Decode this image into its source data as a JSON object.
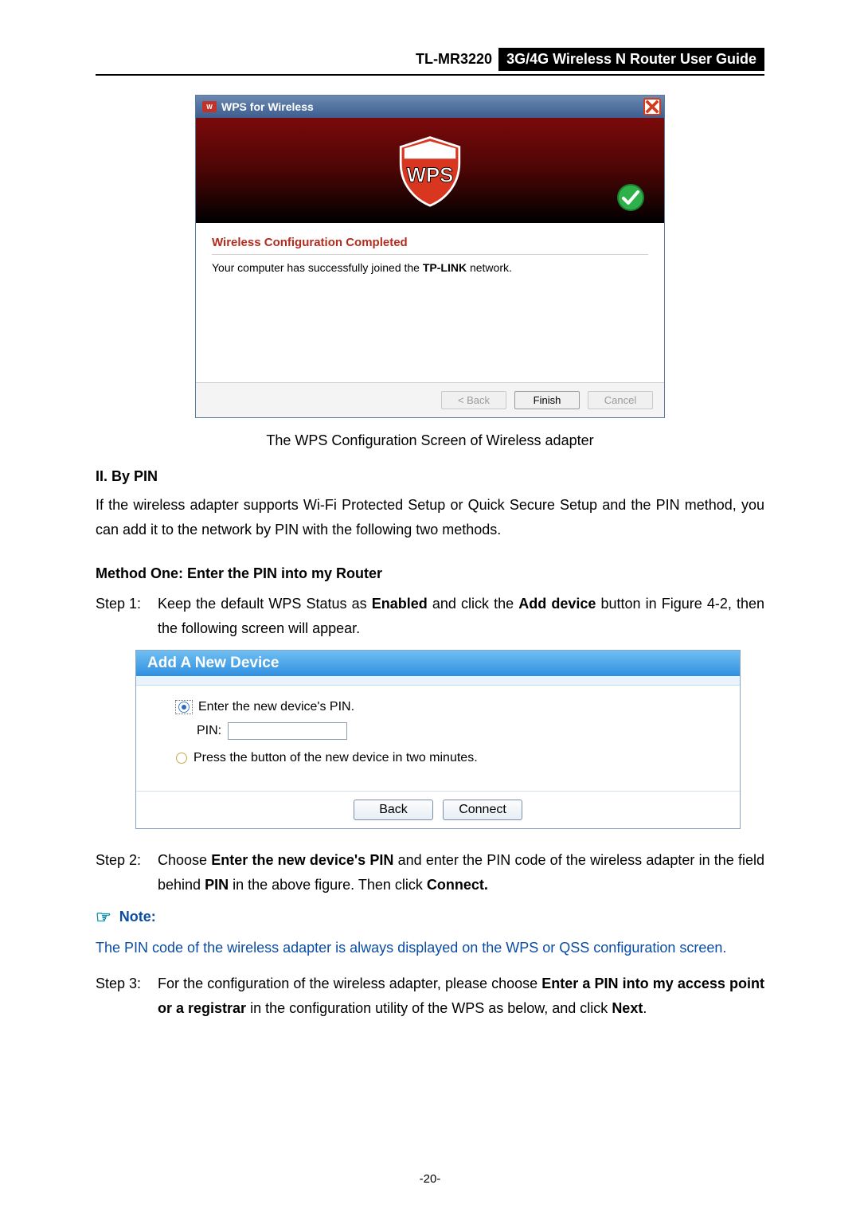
{
  "header": {
    "model": "TL-MR3220",
    "title": "3G/4G Wireless N Router User Guide"
  },
  "wpsDialog": {
    "titlebar": "WPS for Wireless",
    "statusTitle": "Wireless Configuration Completed",
    "statusPrefix": "Your computer has successfully joined the ",
    "networkName": "TP-LINK",
    "statusSuffix": " network.",
    "back": "< Back",
    "finish": "Finish",
    "cancel": "Cancel"
  },
  "caption1": "The WPS Configuration Screen of Wireless adapter",
  "sectionII": "II.   By PIN",
  "introPara": "If the wireless adapter supports Wi-Fi Protected Setup or Quick Secure Setup and the PIN method, you can add it to the network by PIN with the following two methods.",
  "methodOne": "Method One: Enter the PIN into my Router",
  "step1Label": "Step 1:",
  "step1a": "Keep the default WPS Status as ",
  "step1b": "Enabled",
  "step1c": " and click the ",
  "step1d": "Add device",
  "step1e": " button in Figure 4-2, then the following screen will appear.",
  "addDevice": {
    "header": "Add A New Device",
    "opt1": "Enter the new device's PIN.",
    "pinLabel": "PIN:",
    "opt2": "Press the button of the new device in two minutes.",
    "back": "Back",
    "connect": "Connect"
  },
  "step2Label": "Step 2:",
  "step2a": "Choose ",
  "step2b": "Enter the new device's PIN",
  "step2c": " and enter the PIN code of the wireless adapter in the field behind ",
  "step2d": "PIN",
  "step2e": " in the above figure. Then click ",
  "step2f": "Connect.",
  "noteHead": "Note:",
  "noteBody": "The PIN code of the wireless adapter is always displayed on the WPS or QSS configuration screen.",
  "step3Label": "Step 3:",
  "step3a": "For the configuration of the wireless adapter, please choose ",
  "step3b": "Enter a PIN into my access point or a registrar",
  "step3c": " in the configuration utility of the WPS as below, and click ",
  "step3d": "Next",
  "step3e": ".",
  "pageNum": "-20-"
}
